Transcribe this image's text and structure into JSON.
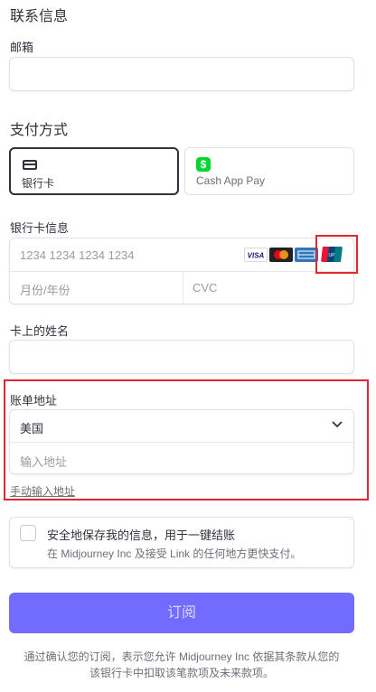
{
  "contact": {
    "title": "联系信息",
    "email_label": "邮箱",
    "email_value": ""
  },
  "payment": {
    "title": "支付方式",
    "methods": [
      {
        "label": "银行卡",
        "icon": "card-icon"
      },
      {
        "label": "Cash App Pay",
        "icon": "cashapp-icon"
      }
    ],
    "selected": "银行卡"
  },
  "card": {
    "label": "银行卡信息",
    "number_placeholder": "1234 1234 1234 1234",
    "expiry_placeholder": "月份/年份",
    "cvc_placeholder": "CVC",
    "brands": [
      {
        "name": "VISA",
        "color": "#1a1f71"
      },
      {
        "name": "Mastercard",
        "color": "#eb001b"
      },
      {
        "name": "AMEX",
        "color": "#2e77bb"
      },
      {
        "name": "UnionPay",
        "color": "#e21836"
      }
    ]
  },
  "name": {
    "label": "卡上的姓名",
    "value": ""
  },
  "billing": {
    "label": "账单地址",
    "country": "美国",
    "address_placeholder": "输入地址",
    "manual_link": "手动输入地址"
  },
  "save": {
    "title": "安全地保存我的信息，用于一键结账",
    "subtitle": "在 Midjourney Inc 及接受 Link 的任何地方更快支付。"
  },
  "subscribe_label": "订阅",
  "terms": {
    "line1": "通过确认您的订阅，表示您允许 Midjourney Inc 依据其条款从您的",
    "line2": "该银行卡中扣取该笔款项及未来款项。"
  },
  "colors": {
    "accent": "#635bff",
    "highlight": "#e3262f",
    "cashapp": "#00d632"
  }
}
